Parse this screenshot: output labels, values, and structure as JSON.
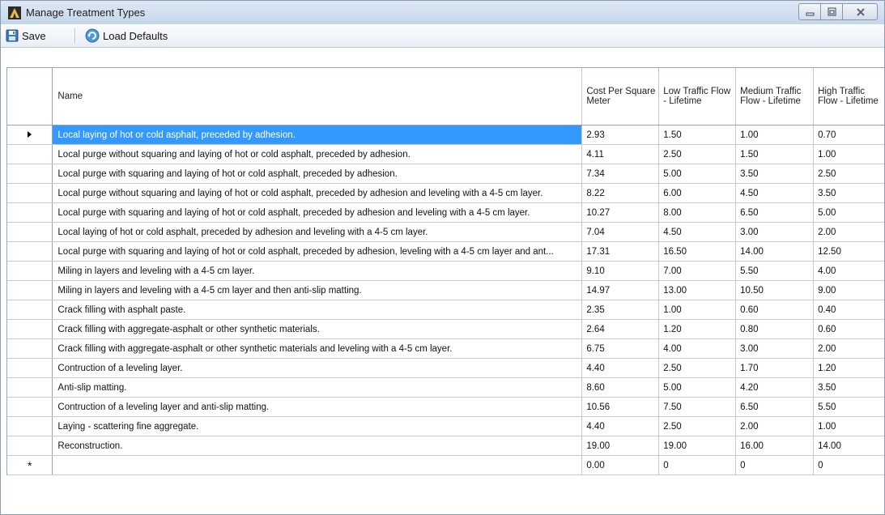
{
  "window": {
    "title": "Manage Treatment Types"
  },
  "toolbar": {
    "save_label": "Save",
    "load_defaults_label": "Load Defaults"
  },
  "table": {
    "headers": {
      "name": "Name",
      "cost": "Cost Per Square Meter",
      "low": "Low Traffic Flow - Lifetime",
      "medium": "Medium Traffic Flow - Lifetime",
      "high": "High Traffic Flow - Lifetime"
    },
    "rows": [
      {
        "name": "Local laying of hot or cold asphalt, preceded by adhesion.",
        "cost": "2.93",
        "low": "1.50",
        "medium": "1.00",
        "high": "0.70"
      },
      {
        "name": "Local purge without squaring and laying of hot or cold asphalt, preceded by adhesion.",
        "cost": "4.11",
        "low": "2.50",
        "medium": "1.50",
        "high": "1.00"
      },
      {
        "name": "Local purge with squaring and laying of hot or cold asphalt, preceded by adhesion.",
        "cost": "7.34",
        "low": "5.00",
        "medium": "3.50",
        "high": "2.50"
      },
      {
        "name": "Local purge without squaring and laying of hot or cold asphalt, preceded by adhesion and leveling with a 4-5 cm layer.",
        "cost": "8.22",
        "low": "6.00",
        "medium": "4.50",
        "high": "3.50"
      },
      {
        "name": "Local purge with squaring and laying of hot or cold asphalt, preceded by adhesion and leveling with a 4-5 cm layer.",
        "cost": "10.27",
        "low": "8.00",
        "medium": "6.50",
        "high": "5.00"
      },
      {
        "name": "Local laying of hot or cold asphalt, preceded by adhesion and leveling with a 4-5 cm layer.",
        "cost": "7.04",
        "low": "4.50",
        "medium": "3.00",
        "high": "2.00"
      },
      {
        "name": "Local purge with squaring and laying of hot or cold asphalt, preceded by adhesion, leveling with a 4-5 cm layer and ant...",
        "cost": "17.31",
        "low": "16.50",
        "medium": "14.00",
        "high": "12.50"
      },
      {
        "name": "Miling in layers and leveling with a 4-5 cm layer.",
        "cost": "9.10",
        "low": "7.00",
        "medium": "5.50",
        "high": "4.00"
      },
      {
        "name": "Miling in layers and leveling with a 4-5 cm layer and then anti-slip matting.",
        "cost": "14.97",
        "low": "13.00",
        "medium": "10.50",
        "high": "9.00"
      },
      {
        "name": "Crack filling with asphalt paste.",
        "cost": "2.35",
        "low": "1.00",
        "medium": "0.60",
        "high": "0.40"
      },
      {
        "name": "Crack filling with aggregate-asphalt or other synthetic materials.",
        "cost": "2.64",
        "low": "1.20",
        "medium": "0.80",
        "high": "0.60"
      },
      {
        "name": "Crack filling with aggregate-asphalt or other synthetic materials and leveling with a 4-5 cm layer.",
        "cost": "6.75",
        "low": "4.00",
        "medium": "3.00",
        "high": "2.00"
      },
      {
        "name": "Contruction of a leveling layer.",
        "cost": "4.40",
        "low": "2.50",
        "medium": "1.70",
        "high": "1.20"
      },
      {
        "name": "Anti-slip matting.",
        "cost": "8.60",
        "low": "5.00",
        "medium": "4.20",
        "high": "3.50"
      },
      {
        "name": "Contruction of a leveling layer and anti-slip matting.",
        "cost": "10.56",
        "low": "7.50",
        "medium": "6.50",
        "high": "5.50"
      },
      {
        "name": "Laying - scattering fine aggregate.",
        "cost": "4.40",
        "low": "2.50",
        "medium": "2.00",
        "high": "1.00"
      },
      {
        "name": "Reconstruction.",
        "cost": "19.00",
        "low": "19.00",
        "medium": "16.00",
        "high": "14.00"
      }
    ],
    "new_row": {
      "name": "",
      "cost": "0.00",
      "low": "0",
      "medium": "0",
      "high": "0"
    },
    "new_row_marker": "*"
  }
}
